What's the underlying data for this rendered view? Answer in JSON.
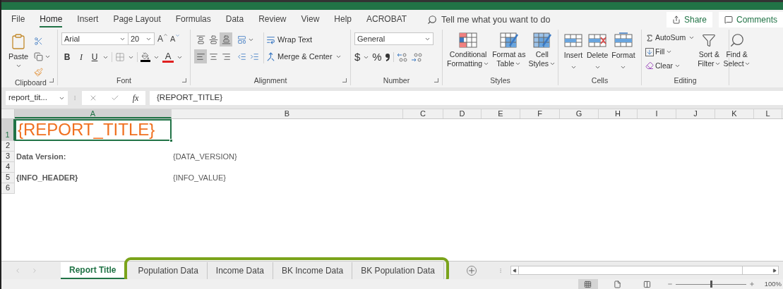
{
  "menu_tabs": [
    {
      "label": "File",
      "selected": false
    },
    {
      "label": "Home",
      "selected": true
    },
    {
      "label": "Insert",
      "selected": false
    },
    {
      "label": "Page Layout",
      "selected": false
    },
    {
      "label": "Formulas",
      "selected": false
    },
    {
      "label": "Data",
      "selected": false
    },
    {
      "label": "Review",
      "selected": false
    },
    {
      "label": "View",
      "selected": false
    },
    {
      "label": "Help",
      "selected": false
    },
    {
      "label": "ACROBAT",
      "selected": false
    }
  ],
  "tell_me": {
    "placeholder": "Tell me what you want to do"
  },
  "share": "Share",
  "comments": "Comments",
  "ribbon": {
    "clipboard": {
      "label": "Clipboard",
      "paste": "Paste"
    },
    "font": {
      "label": "Font",
      "font_name": "Arial",
      "font_size": "20",
      "grow": "A",
      "shrink": "A",
      "bold": "B",
      "italic": "I",
      "underline": "U",
      "font_color": "A"
    },
    "alignment": {
      "label": "Alignment",
      "wrap_text": "Wrap Text",
      "merge_center": "Merge & Center"
    },
    "number": {
      "label": "Number",
      "format": "General",
      "currency": "$",
      "percent": "%"
    },
    "styles": {
      "label": "Styles",
      "buttons": [
        {
          "lines": [
            "Conditional",
            "Formatting"
          ]
        },
        {
          "lines": [
            "Format as",
            "Table"
          ]
        },
        {
          "lines": [
            "Cell",
            "Styles"
          ]
        }
      ]
    },
    "cells": {
      "label": "Cells",
      "buttons": [
        "Insert",
        "Delete",
        "Format"
      ]
    },
    "editing": {
      "label": "Editing",
      "autosum": "AutoSum",
      "fill": "Fill",
      "clear": "Clear",
      "sort": [
        "Sort &",
        "Filter"
      ],
      "find": [
        "Find &",
        "Select"
      ]
    }
  },
  "formula_bar": {
    "name_box": "report_tit...",
    "fx": "fx",
    "formula": "{REPORT_TITLE}"
  },
  "columns": [
    {
      "label": "A",
      "selected": true
    },
    {
      "label": "B",
      "selected": false
    },
    {
      "label": "C",
      "selected": false
    },
    {
      "label": "D",
      "selected": false
    },
    {
      "label": "E",
      "selected": false
    },
    {
      "label": "F",
      "selected": false
    },
    {
      "label": "G",
      "selected": false
    },
    {
      "label": "H",
      "selected": false
    },
    {
      "label": "I",
      "selected": false
    },
    {
      "label": "J",
      "selected": false
    },
    {
      "label": "K",
      "selected": false
    },
    {
      "label": "L",
      "selected": false
    }
  ],
  "rows": [
    {
      "number": "1",
      "selected": true,
      "cells": [
        {
          "text": "{REPORT_TITLE}",
          "kind": "title"
        }
      ]
    },
    {
      "number": "2",
      "selected": false
    },
    {
      "number": "3",
      "selected": false,
      "cells": [
        {
          "text": "Data Version:",
          "kind": "label"
        },
        {
          "text": "{DATA_VERSION}",
          "kind": "value"
        }
      ]
    },
    {
      "number": "4",
      "selected": false
    },
    {
      "number": "5",
      "selected": false,
      "cells": [
        {
          "text": "{INFO_HEADER}",
          "kind": "label"
        },
        {
          "text": "{INFO_VALUE}",
          "kind": "value"
        }
      ]
    },
    {
      "number": "6",
      "selected": false
    }
  ],
  "sheet_tabs": [
    {
      "label": "Report Title",
      "selected": true,
      "highlighted": false
    },
    {
      "label": "Population Data",
      "selected": false,
      "highlighted": true
    },
    {
      "label": "Income Data",
      "selected": false,
      "highlighted": true
    },
    {
      "label": "BK Income Data",
      "selected": false,
      "highlighted": true
    },
    {
      "label": "BK Population Data",
      "selected": false,
      "highlighted": true
    }
  ],
  "status_bar": {
    "view_modes": [
      {
        "kind": "normal",
        "selected": true
      },
      {
        "kind": "page_layout",
        "selected": false
      },
      {
        "kind": "page_break",
        "selected": false
      }
    ],
    "zoom_slider": {
      "level": 0.5
    },
    "zoom": "100%"
  }
}
